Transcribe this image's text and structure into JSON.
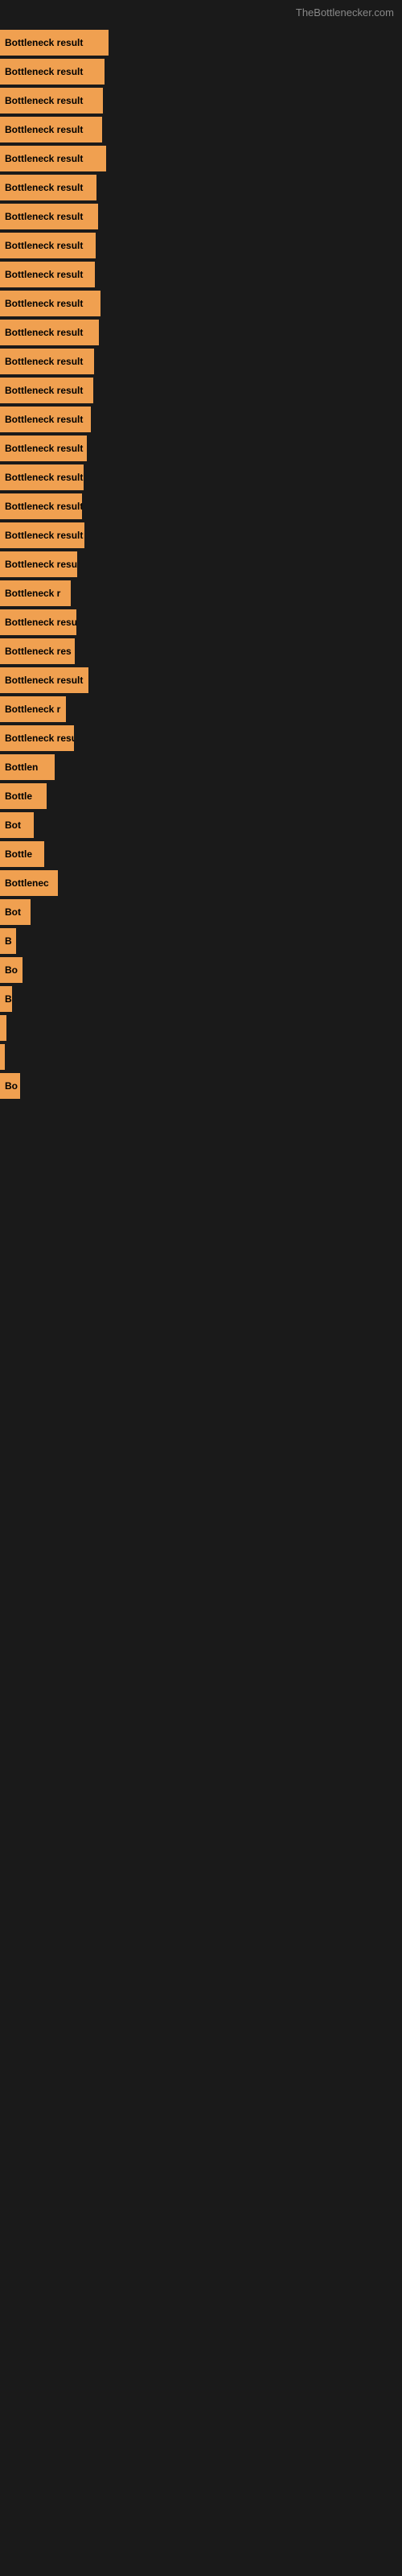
{
  "site": {
    "title": "TheBottlenecker.com"
  },
  "bars": [
    {
      "id": 1,
      "label": "Bottleneck result",
      "width": 135
    },
    {
      "id": 2,
      "label": "Bottleneck result",
      "width": 130
    },
    {
      "id": 3,
      "label": "Bottleneck result",
      "width": 128
    },
    {
      "id": 4,
      "label": "Bottleneck result",
      "width": 127
    },
    {
      "id": 5,
      "label": "Bottleneck result",
      "width": 132
    },
    {
      "id": 6,
      "label": "Bottleneck result",
      "width": 120
    },
    {
      "id": 7,
      "label": "Bottleneck result",
      "width": 122
    },
    {
      "id": 8,
      "label": "Bottleneck result",
      "width": 119
    },
    {
      "id": 9,
      "label": "Bottleneck result",
      "width": 118
    },
    {
      "id": 10,
      "label": "Bottleneck result",
      "width": 125
    },
    {
      "id": 11,
      "label": "Bottleneck result",
      "width": 123
    },
    {
      "id": 12,
      "label": "Bottleneck result",
      "width": 117
    },
    {
      "id": 13,
      "label": "Bottleneck result",
      "width": 116
    },
    {
      "id": 14,
      "label": "Bottleneck result",
      "width": 113
    },
    {
      "id": 15,
      "label": "Bottleneck result",
      "width": 108
    },
    {
      "id": 16,
      "label": "Bottleneck result",
      "width": 104
    },
    {
      "id": 17,
      "label": "Bottleneck result",
      "width": 102
    },
    {
      "id": 18,
      "label": "Bottleneck result",
      "width": 105
    },
    {
      "id": 19,
      "label": "Bottleneck resu",
      "width": 96
    },
    {
      "id": 20,
      "label": "Bottleneck r",
      "width": 88
    },
    {
      "id": 21,
      "label": "Bottleneck resu",
      "width": 95
    },
    {
      "id": 22,
      "label": "Bottleneck res",
      "width": 93
    },
    {
      "id": 23,
      "label": "Bottleneck result",
      "width": 110
    },
    {
      "id": 24,
      "label": "Bottleneck r",
      "width": 82
    },
    {
      "id": 25,
      "label": "Bottleneck resu",
      "width": 92
    },
    {
      "id": 26,
      "label": "Bottlen",
      "width": 68
    },
    {
      "id": 27,
      "label": "Bottle",
      "width": 58
    },
    {
      "id": 28,
      "label": "Bot",
      "width": 42
    },
    {
      "id": 29,
      "label": "Bottle",
      "width": 55
    },
    {
      "id": 30,
      "label": "Bottlenec",
      "width": 72
    },
    {
      "id": 31,
      "label": "Bot",
      "width": 38
    },
    {
      "id": 32,
      "label": "B",
      "width": 20
    },
    {
      "id": 33,
      "label": "Bo",
      "width": 28
    },
    {
      "id": 34,
      "label": "B",
      "width": 15
    },
    {
      "id": 35,
      "label": "",
      "width": 8
    },
    {
      "id": 36,
      "label": "",
      "width": 4
    },
    {
      "id": 37,
      "label": "Bo",
      "width": 25
    }
  ]
}
